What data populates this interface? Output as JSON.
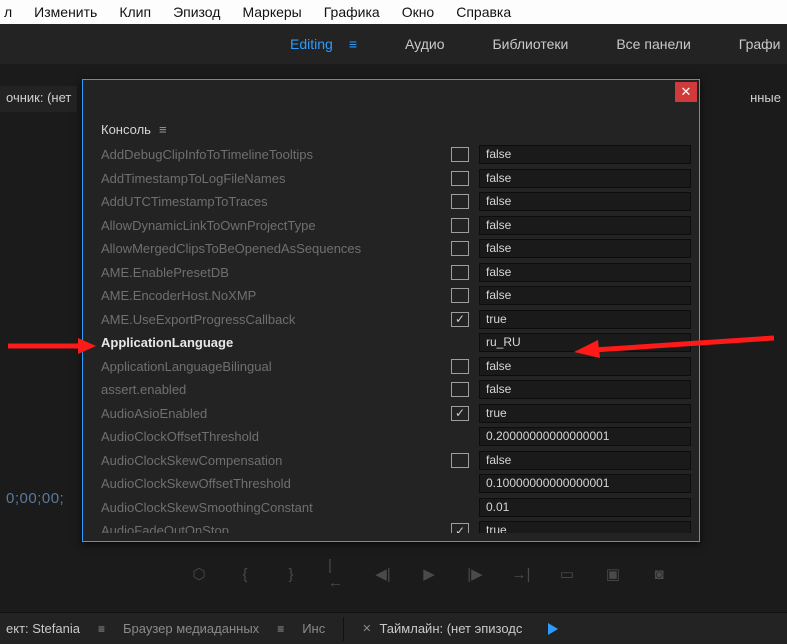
{
  "menubar": {
    "items": [
      "Изменить",
      "Клип",
      "Эпизод",
      "Маркеры",
      "Графика",
      "Окно",
      "Справка"
    ]
  },
  "workspaces": {
    "items": [
      {
        "label": "Editing",
        "active": true
      },
      {
        "label": "Аудио",
        "active": false
      },
      {
        "label": "Библиотеки",
        "active": false
      },
      {
        "label": "Все панели",
        "active": false
      },
      {
        "label": "Графи",
        "active": false
      }
    ]
  },
  "bg": {
    "source_tab": "очник: (нет",
    "effects_tab": "нные",
    "timecode": "0;00;00;"
  },
  "dialog": {
    "title": "Консоль",
    "rows": [
      {
        "name": "AddDebugClipInfoToTimelineTooltips",
        "checkbox": "unchecked",
        "value": "false"
      },
      {
        "name": "AddTimestampToLogFileNames",
        "checkbox": "unchecked",
        "value": "false"
      },
      {
        "name": "AddUTCTimestampToTraces",
        "checkbox": "unchecked",
        "value": "false"
      },
      {
        "name": "AllowDynamicLinkToOwnProjectType",
        "checkbox": "unchecked",
        "value": "false"
      },
      {
        "name": "AllowMergedClipsToBeOpenedAsSequences",
        "checkbox": "unchecked",
        "value": "false"
      },
      {
        "name": "AME.EnablePresetDB",
        "checkbox": "unchecked",
        "value": "false"
      },
      {
        "name": "AME.EncoderHost.NoXMP",
        "checkbox": "unchecked",
        "value": "false"
      },
      {
        "name": "AME.UseExportProgressCallback",
        "checkbox": "checked",
        "value": "true"
      },
      {
        "name": "ApplicationLanguage",
        "checkbox": "none",
        "value": "ru_RU",
        "highlight": true
      },
      {
        "name": "ApplicationLanguageBilingual",
        "checkbox": "unchecked",
        "value": "false"
      },
      {
        "name": "assert.enabled",
        "checkbox": "unchecked",
        "value": "false"
      },
      {
        "name": "AudioAsioEnabled",
        "checkbox": "checked",
        "value": "true"
      },
      {
        "name": "AudioClockOffsetThreshold",
        "checkbox": "none",
        "value": "0.20000000000000001"
      },
      {
        "name": "AudioClockSkewCompensation",
        "checkbox": "unchecked",
        "value": "false"
      },
      {
        "name": "AudioClockSkewOffsetThreshold",
        "checkbox": "none",
        "value": "0.10000000000000001"
      },
      {
        "name": "AudioClockSkewSmoothingConstant",
        "checkbox": "none",
        "value": "0.01"
      },
      {
        "name": "AudioFadeOutOnStop",
        "checkbox": "checked",
        "value": "true"
      }
    ]
  },
  "bottom": {
    "project": "ект: Stefania",
    "media_browser": "Браузер медиаданных",
    "info_short": "Инс",
    "timeline": "Таймлайн: (нет эпизодс"
  }
}
